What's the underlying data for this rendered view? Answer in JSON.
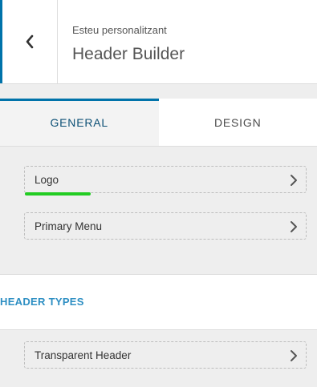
{
  "header": {
    "back_icon": "chevron-left-icon",
    "breadcrumb": "Esteu personalitzant",
    "title": "Header Builder"
  },
  "tabs": [
    {
      "label": "GENERAL",
      "active": true
    },
    {
      "label": "DESIGN",
      "active": false
    }
  ],
  "components": [
    {
      "label": "Logo",
      "icon": "chevron-right-icon"
    },
    {
      "label": "Primary Menu",
      "icon": "chevron-right-icon"
    }
  ],
  "header_types": {
    "title": "HEADER TYPES",
    "items": [
      {
        "label": "Transparent Header",
        "icon": "chevron-right-icon"
      }
    ]
  },
  "colors": {
    "accent": "#0073aa",
    "section_title": "#2e8fc3",
    "highlight": "#22cc22"
  }
}
